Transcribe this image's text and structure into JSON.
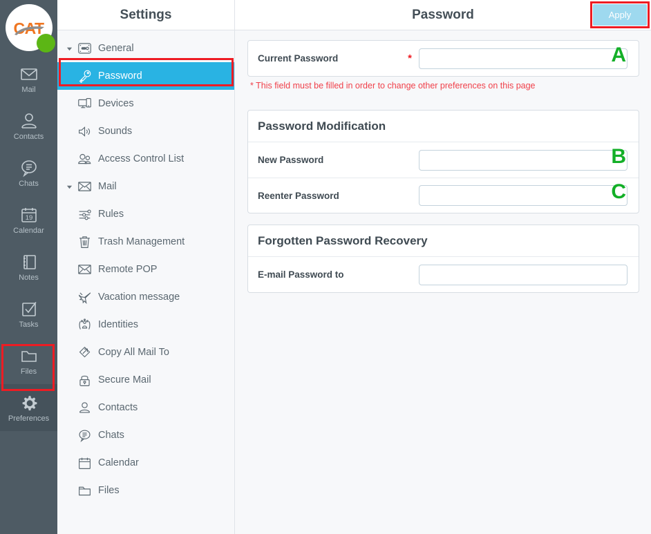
{
  "brand": {
    "logo_text": "CAT",
    "status_dot_color": "#5cb615",
    "logo_color": "#ef7622"
  },
  "colors": {
    "rail_bg": "#4e5b64",
    "rail_active_bg": "#45525b",
    "selected_tree_item": "#29b3e3",
    "apply_button": "#9ed9ef",
    "annotation_red": "#ee1c23",
    "annotation_green": "#13af27",
    "required_star": "#ee1c23",
    "page_bg": "#f7f8fa"
  },
  "rail": {
    "items": [
      {
        "label": "Mail",
        "icon": "mail-icon",
        "active": false
      },
      {
        "label": "Contacts",
        "icon": "contacts-icon",
        "active": false
      },
      {
        "label": "Chats",
        "icon": "chats-icon",
        "active": false
      },
      {
        "label": "Calendar",
        "icon": "calendar-icon",
        "active": false
      },
      {
        "label": "Notes",
        "icon": "notes-icon",
        "active": false
      },
      {
        "label": "Tasks",
        "icon": "tasks-icon",
        "active": false
      },
      {
        "label": "Files",
        "icon": "files-icon",
        "active": false
      },
      {
        "label": "Preferences",
        "icon": "gear-icon",
        "active": true
      }
    ],
    "calendar_day": "19"
  },
  "settings_panel": {
    "title": "Settings",
    "tree": [
      {
        "label": "General",
        "icon": "general-icon",
        "level": "group",
        "expanded": true,
        "selected": false
      },
      {
        "label": "Password",
        "icon": "key-icon",
        "level": "child",
        "selected": true
      },
      {
        "label": "Devices",
        "icon": "devices-icon",
        "level": "child",
        "selected": false
      },
      {
        "label": "Sounds",
        "icon": "sounds-icon",
        "level": "child",
        "selected": false
      },
      {
        "label": "Access Control List",
        "icon": "access-control-icon",
        "level": "child",
        "selected": false
      },
      {
        "label": "Mail",
        "icon": "mail-envelope-icon",
        "level": "group",
        "expanded": true,
        "selected": false
      },
      {
        "label": "Rules",
        "icon": "rules-icon",
        "level": "child",
        "selected": false
      },
      {
        "label": "Trash Management",
        "icon": "trash-icon",
        "level": "child",
        "selected": false
      },
      {
        "label": "Remote POP",
        "icon": "envelope-icon",
        "level": "child",
        "selected": false
      },
      {
        "label": "Vacation message",
        "icon": "airplane-icon",
        "level": "child",
        "selected": false
      },
      {
        "label": "Identities",
        "icon": "identities-icon",
        "level": "child",
        "selected": false
      },
      {
        "label": "Copy All Mail To",
        "icon": "copy-arrows-icon",
        "level": "child",
        "selected": false
      },
      {
        "label": "Secure Mail",
        "icon": "lock-icon",
        "level": "child",
        "selected": false
      },
      {
        "label": "Contacts",
        "icon": "person-icon",
        "level": "root",
        "selected": false
      },
      {
        "label": "Chats",
        "icon": "chat-bubble-icon",
        "level": "root",
        "selected": false
      },
      {
        "label": "Calendar",
        "icon": "calendar-outline-icon",
        "level": "root",
        "selected": false
      },
      {
        "label": "Files",
        "icon": "folder-icon",
        "level": "root",
        "selected": false
      }
    ]
  },
  "main": {
    "title": "Password",
    "apply_label": "Apply",
    "current_password": {
      "label": "Current Password",
      "required_marker": "*",
      "value": "",
      "placeholder": "",
      "annotation": "A"
    },
    "required_note": "* This field must be filled in order to change other preferences on this page",
    "password_modification": {
      "title": "Password Modification",
      "fields": [
        {
          "label": "New Password",
          "value": "",
          "placeholder": "",
          "annotation": "B"
        },
        {
          "label": "Reenter Password",
          "value": "",
          "placeholder": "",
          "annotation": "C"
        }
      ]
    },
    "forgotten_password_recovery": {
      "title": "Forgotten Password Recovery",
      "fields": [
        {
          "label": "E-mail Password to",
          "value": "",
          "placeholder": "",
          "annotation": ""
        }
      ]
    }
  }
}
